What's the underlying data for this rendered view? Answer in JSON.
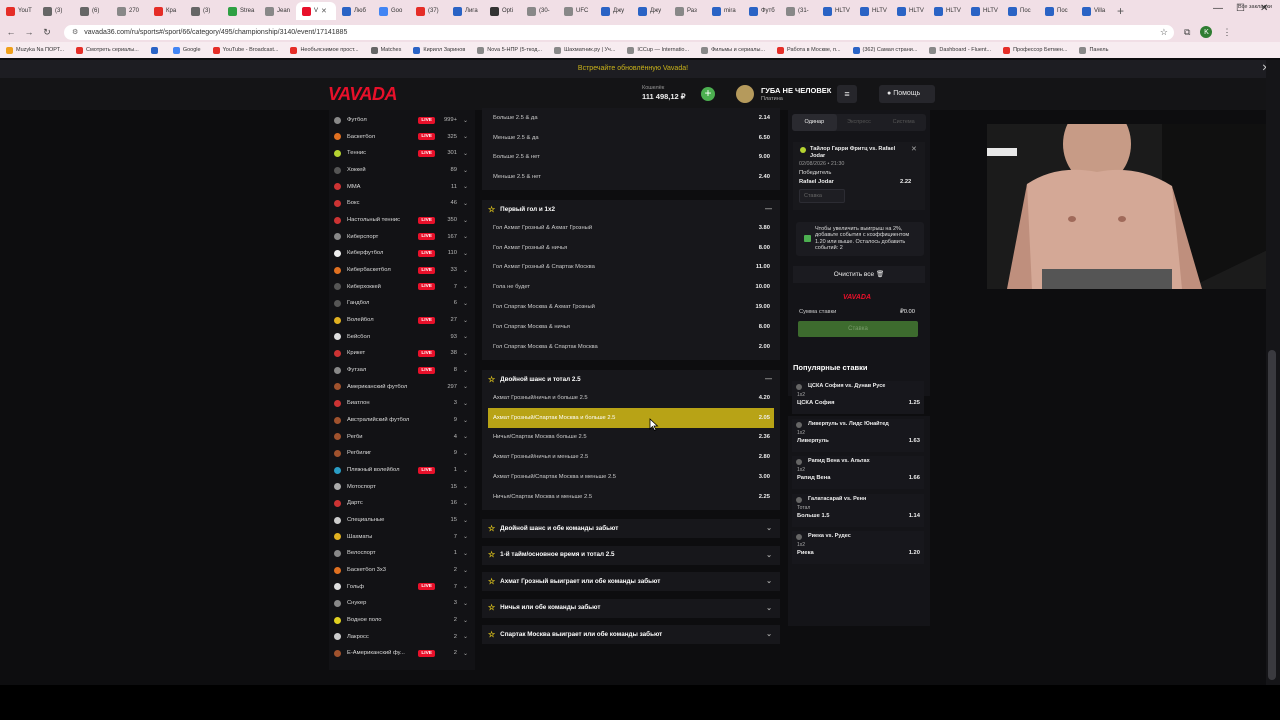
{
  "browser": {
    "tabs": [
      {
        "title": "YouT",
        "color": "#e52d27"
      },
      {
        "title": "(3)",
        "color": "#666666"
      },
      {
        "title": "(6)",
        "color": "#666666"
      },
      {
        "title": "270",
        "color": "#888888"
      },
      {
        "title": "Кра",
        "color": "#e52d27"
      },
      {
        "title": "(3)",
        "color": "#666666"
      },
      {
        "title": "Strea",
        "color": "#2ea043"
      },
      {
        "title": "Jean",
        "color": "#888888"
      },
      {
        "title": "V",
        "color": "#e8102a",
        "active": true
      },
      {
        "title": "Люб",
        "color": "#2a63c5"
      },
      {
        "title": "Goo",
        "color": "#4285f4"
      },
      {
        "title": "(37)",
        "color": "#e52d27"
      },
      {
        "title": "Лига",
        "color": "#2a63c5"
      },
      {
        "title": "Opti",
        "color": "#333333"
      },
      {
        "title": "(30-",
        "color": "#888888"
      },
      {
        "title": "UFC",
        "color": "#888888"
      },
      {
        "title": "Джу",
        "color": "#2a63c5"
      },
      {
        "title": "Джу",
        "color": "#2a63c5"
      },
      {
        "title": "Раз",
        "color": "#888888"
      },
      {
        "title": "mira",
        "color": "#2a63c5"
      },
      {
        "title": "Футб",
        "color": "#2a63c5"
      },
      {
        "title": "(31-",
        "color": "#888888"
      },
      {
        "title": "HLTV",
        "color": "#2a63c5"
      },
      {
        "title": "HLTV",
        "color": "#2a63c5"
      },
      {
        "title": "HLTV",
        "color": "#2a63c5"
      },
      {
        "title": "HLTV",
        "color": "#2a63c5"
      },
      {
        "title": "HLTV",
        "color": "#2a63c5"
      },
      {
        "title": "Пос",
        "color": "#2a63c5"
      },
      {
        "title": "Пос",
        "color": "#2a63c5"
      },
      {
        "title": "Villa",
        "color": "#2a63c5"
      }
    ],
    "url": "vavada36.com/ru/sports#/sport/66/category/495/championship/3140/event/17141885",
    "profile_letter": "K",
    "bookmarks": [
      {
        "title": "Muzyka Na ПОРТ...",
        "color": "#f0a01a"
      },
      {
        "title": "Смотреть сериалы...",
        "color": "#e52d27"
      },
      {
        "title": "",
        "color": "#2a63c5"
      },
      {
        "title": "Google",
        "color": "#4285f4"
      },
      {
        "title": "YouTube - Broadcast...",
        "color": "#e52d27"
      },
      {
        "title": "Необъяснимое прост...",
        "color": "#e52d27"
      },
      {
        "title": "Matches",
        "color": "#666666"
      },
      {
        "title": "Кирилл Заринов",
        "color": "#2a63c5"
      },
      {
        "title": "Nova 5-НПР (5-ткод...",
        "color": "#888888"
      },
      {
        "title": "Шахматник.ру | Уч...",
        "color": "#888888"
      },
      {
        "title": "ICCup — Internatio...",
        "color": "#888888"
      },
      {
        "title": "Фильмы и сериалы...",
        "color": "#888888"
      },
      {
        "title": "Работа в Москве, п...",
        "color": "#e52d27"
      },
      {
        "title": "(362) Самая страни...",
        "color": "#2a63c5"
      },
      {
        "title": "Dashboard - Fluent...",
        "color": "#888888"
      },
      {
        "title": "Профессор Бетмен...",
        "color": "#e52d27"
      },
      {
        "title": "Панель",
        "color": "#888888"
      }
    ],
    "all_bookmarks": "Все закладки"
  },
  "site": {
    "promo": "Встречайте обновлённую Vavada!",
    "logo": "VAVADA",
    "wallet_label": "Кошелёк",
    "wallet_amount": "111 498,12 ₽",
    "username": "ГУБА НЕ ЧЕЛОВЕК",
    "user_level": "Платина",
    "help": "Помощь",
    "colors": {
      "brand": "#e8102a",
      "live": "#e8102a",
      "selected": "#b8a316",
      "accent_star": "#e0c51c"
    }
  },
  "sports": [
    {
      "name": "Футбол",
      "live": true,
      "count": "999+",
      "color": "#888888"
    },
    {
      "name": "Баскетбол",
      "live": true,
      "count": "325",
      "color": "#e07020"
    },
    {
      "name": "Теннис",
      "live": true,
      "count": "301",
      "color": "#b5d331"
    },
    {
      "name": "Хоккей",
      "live": false,
      "count": "89",
      "color": "#555555"
    },
    {
      "name": "MMA",
      "live": false,
      "count": "11",
      "color": "#cc3333"
    },
    {
      "name": "Бокс",
      "live": false,
      "count": "46",
      "color": "#cc3333"
    },
    {
      "name": "Настольный теннис",
      "live": true,
      "count": "350",
      "color": "#cc3333"
    },
    {
      "name": "Киберспорт",
      "live": true,
      "count": "167",
      "color": "#888888"
    },
    {
      "name": "Киберфутбол",
      "live": true,
      "count": "110",
      "color": "#eeeeee"
    },
    {
      "name": "Кибербаскетбол",
      "live": true,
      "count": "33",
      "color": "#e07020"
    },
    {
      "name": "Киберхоккей",
      "live": true,
      "count": "7",
      "color": "#555555"
    },
    {
      "name": "Гандбол",
      "live": false,
      "count": "6",
      "color": "#555555"
    },
    {
      "name": "Волейбол",
      "live": true,
      "count": "27",
      "color": "#e0b020"
    },
    {
      "name": "Бейсбол",
      "live": false,
      "count": "93",
      "color": "#dddddd"
    },
    {
      "name": "Крикет",
      "live": true,
      "count": "38",
      "color": "#cc3333"
    },
    {
      "name": "Футзал",
      "live": true,
      "count": "8",
      "color": "#888888"
    },
    {
      "name": "Американский футбол",
      "live": false,
      "count": "297",
      "color": "#a0522d"
    },
    {
      "name": "Биатлон",
      "live": false,
      "count": "3",
      "color": "#cc3333"
    },
    {
      "name": "Австралийский футбол",
      "live": false,
      "count": "9",
      "color": "#a0522d"
    },
    {
      "name": "Регби",
      "live": false,
      "count": "4",
      "color": "#a0522d"
    },
    {
      "name": "Регбилиг",
      "live": false,
      "count": "9",
      "color": "#a0522d"
    },
    {
      "name": "Пляжный волейбол",
      "live": true,
      "count": "1",
      "color": "#2a9dc5"
    },
    {
      "name": "Мотоспорт",
      "live": false,
      "count": "15",
      "color": "#aaaaaa"
    },
    {
      "name": "Дартс",
      "live": false,
      "count": "16",
      "color": "#cc3333"
    },
    {
      "name": "Специальные",
      "live": false,
      "count": "15",
      "color": "#cccccc"
    },
    {
      "name": "Шахматы",
      "live": false,
      "count": "7",
      "color": "#e0b020"
    },
    {
      "name": "Велоспорт",
      "live": false,
      "count": "1",
      "color": "#888888"
    },
    {
      "name": "Баскетбол 3х3",
      "live": false,
      "count": "2",
      "color": "#e07020"
    },
    {
      "name": "Гольф",
      "live": true,
      "count": "7",
      "color": "#dddddd"
    },
    {
      "name": "Снукер",
      "live": false,
      "count": "3",
      "color": "#888888"
    },
    {
      "name": "Водное поло",
      "live": false,
      "count": "2",
      "color": "#e0d020"
    },
    {
      "name": "Лакросс",
      "live": false,
      "count": "2",
      "color": "#cccccc"
    },
    {
      "name": "E-Американский фу...",
      "live": true,
      "count": "2",
      "color": "#a0522d"
    }
  ],
  "markets": {
    "top_rows": [
      {
        "label": "Больше 2.5 & да",
        "odd": "2.14"
      },
      {
        "label": "Меньше 2.5 & да",
        "odd": "6.50"
      },
      {
        "label": "Больше 2.5 & нет",
        "odd": "9.00"
      },
      {
        "label": "Меньше 2.5 & нет",
        "odd": "2.40"
      }
    ],
    "first_goal": {
      "title": "Первый гол и 1x2",
      "rows": [
        {
          "label": "Гол Ахмат Грозный & Ахмат Грозный",
          "odd": "3.80"
        },
        {
          "label": "Гол Ахмат Грозный & ничья",
          "odd": "8.00"
        },
        {
          "label": "Гол Ахмат Грозный & Спартак Москва",
          "odd": "11.00"
        },
        {
          "label": "Гола не будет",
          "odd": "10.00"
        },
        {
          "label": "Гол Спартак Москва & Ахмат Грозный",
          "odd": "19.00"
        },
        {
          "label": "Гол Спартак Москва & ничья",
          "odd": "8.00"
        },
        {
          "label": "Гол Спартак Москва & Спартак Москва",
          "odd": "2.00"
        }
      ]
    },
    "double_chance": {
      "title": "Двойной шанс и тотал 2.5",
      "rows": [
        {
          "label": "Ахмат Грозный/ничья и больше 2.5",
          "odd": "4.20"
        },
        {
          "label": "Ахмат Грозный/Спартак Москва и больше 2.5",
          "odd": "2.05",
          "selected": true
        },
        {
          "label": "Ничья/Спартак Москва больше 2.5",
          "odd": "2.36"
        },
        {
          "label": "Ахмат Грозный/ничья и меньше 2.5",
          "odd": "2.80"
        },
        {
          "label": "Ахмат Грозный/Спартак Москва и меньше 2.5",
          "odd": "3.00"
        },
        {
          "label": "Ничья/Спартак Москва и меньше 2.5",
          "odd": "2.25"
        }
      ]
    },
    "collapsed": [
      "Двойной шанс и обе команды забьют",
      "1-й тайм/основное время и тотал 2.5",
      "Ахмат Грозный выиграет или обе команды забьют",
      "Ничья или обе команды забьют",
      "Спартак Москва выиграет или обе команды забьют"
    ]
  },
  "betslip": {
    "tabs": [
      "Одинар",
      "Экспресс",
      "Система"
    ],
    "event": "Тайлор Гарри Фритц vs. Rafael Jodar",
    "date": "02/08/2026 • 21:30",
    "market": "Победитель",
    "pick": "Rafael Jodar",
    "odd": "2.22",
    "stake_placeholder": "Ставка",
    "bonus_text": "Чтобы увеличить выигрыш на 2%, добавьте события с коэффициентом 1.20 или выше. Осталось добавить событий: 2",
    "clear_all": "Очистить все",
    "logo": "VAVADA",
    "sum_label": "Сумма ставки",
    "sum_value": "₽0.00",
    "place": "Ставка"
  },
  "popular": {
    "title": "Популярные ставки",
    "items": [
      {
        "event": "ЦСКА София vs. Дунав Русе",
        "market": "1x2",
        "pick": "ЦСКА София",
        "odd": "1.25"
      },
      {
        "event": "Ливерпуль vs. Лидс Юнайтед",
        "market": "1x2",
        "pick": "Ливерпуль",
        "odd": "1.63"
      },
      {
        "event": "Рапид Вена vs. Альтах",
        "market": "1x2",
        "pick": "Рапид Вена",
        "odd": "1.66"
      },
      {
        "event": "Галатасарай vs. Ренн",
        "market": "Тотал",
        "pick": "Больше 1.5",
        "odd": "1.14"
      },
      {
        "event": "Риека vs. Рудес",
        "market": "1x2",
        "pick": "Риека",
        "odd": "1.20"
      }
    ]
  }
}
